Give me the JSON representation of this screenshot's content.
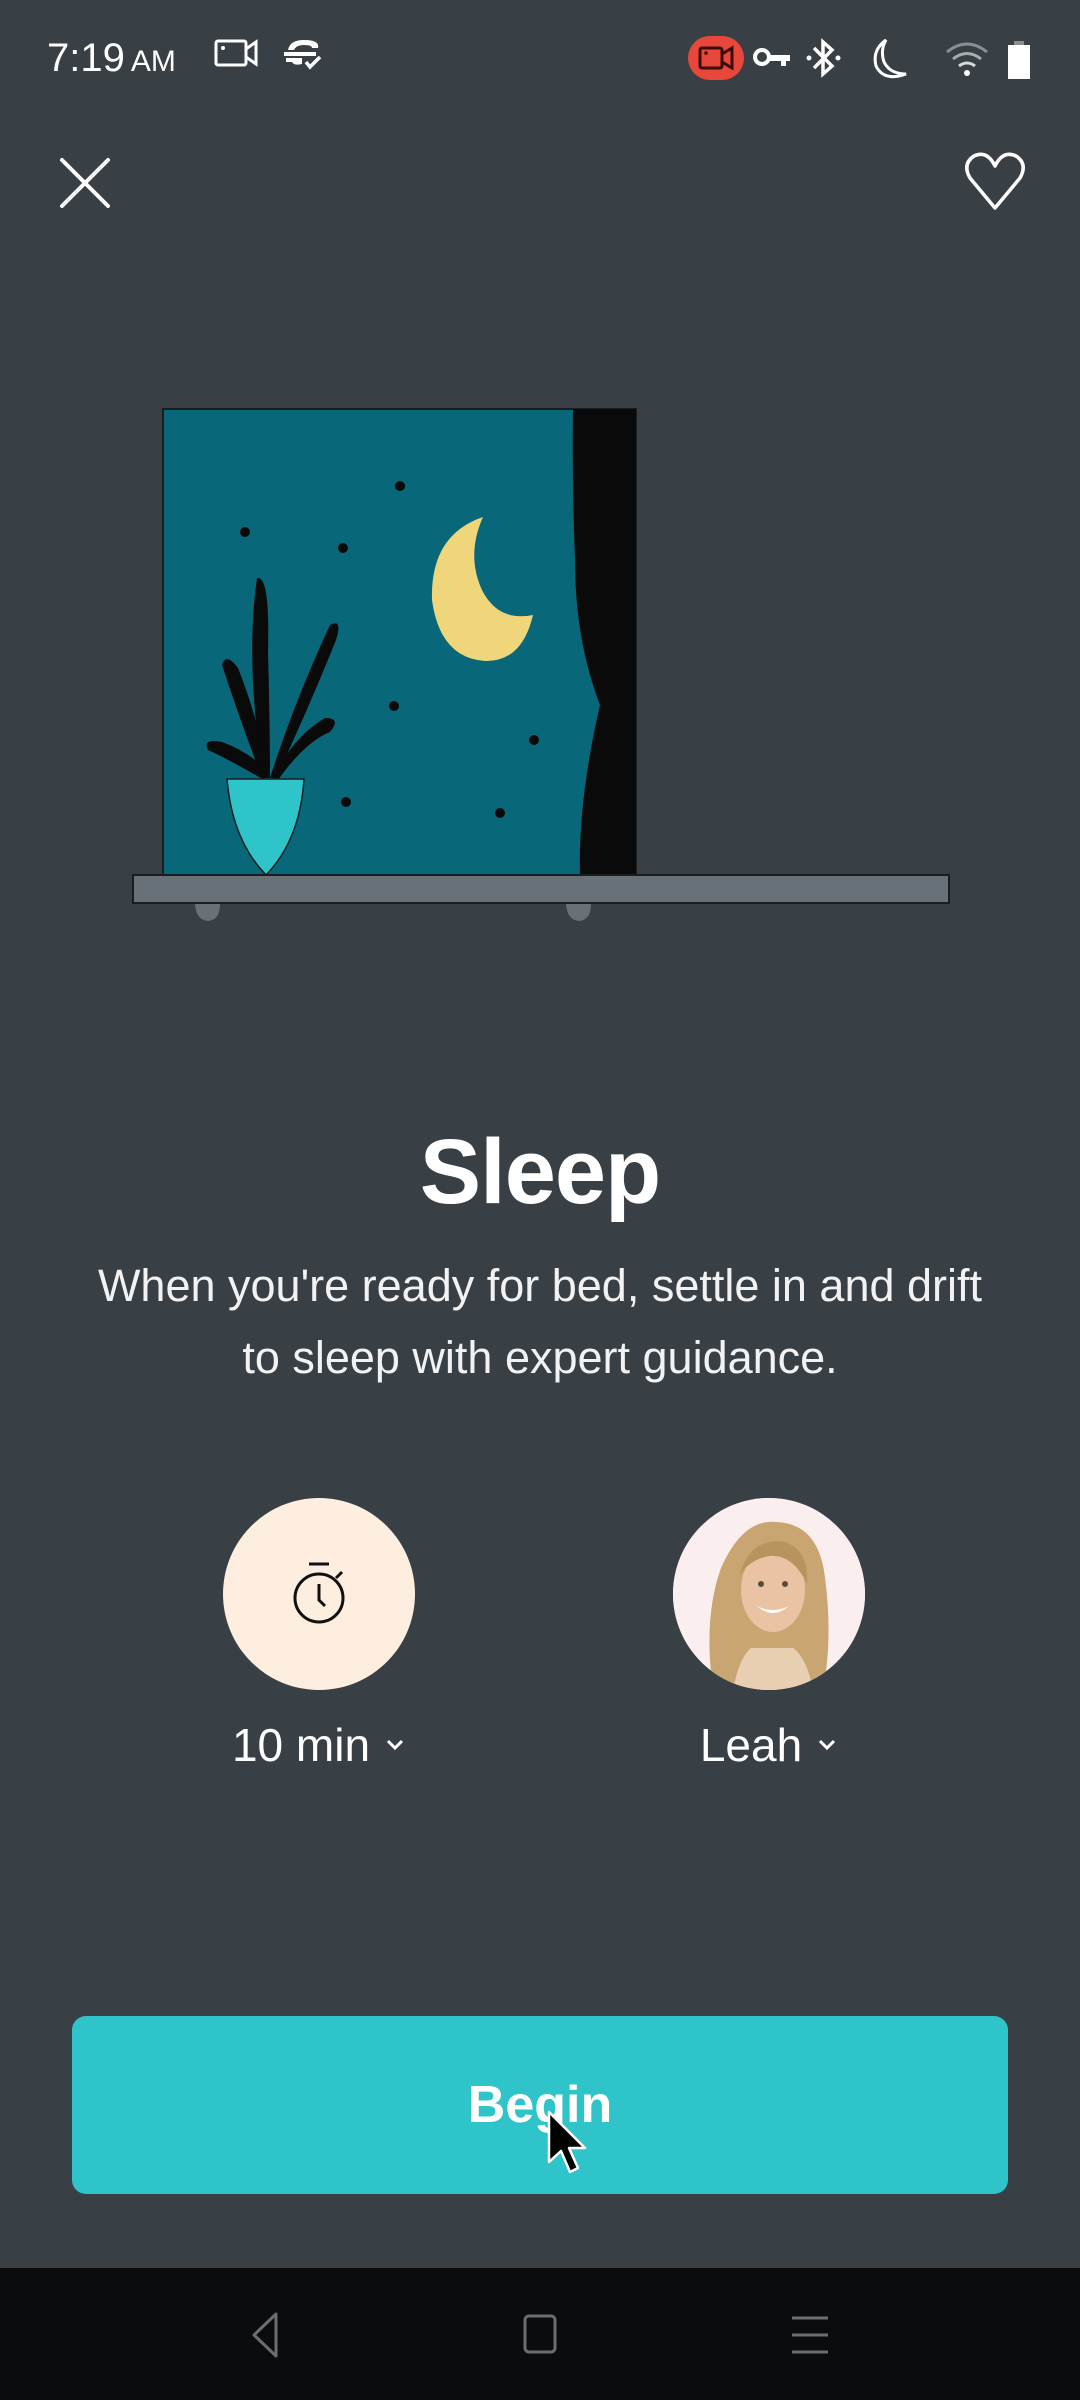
{
  "status_bar": {
    "time": "7:19",
    "ampm": "AM",
    "icons": [
      "video-camera-icon",
      "sync-check-icon",
      "screen-record-icon",
      "vpn-key-icon",
      "bluetooth-icon",
      "do-not-disturb-moon-icon",
      "wifi-icon",
      "battery-icon"
    ],
    "record_indicator_color": "#e8473c"
  },
  "header": {
    "close_icon": "close-icon",
    "favorite_icon": "heart-outline-icon"
  },
  "illustration": {
    "subject": "night window with crescent moon, stars, potted plant and curtain",
    "colors": {
      "sky": "#09677a",
      "moon": "#f0d67a",
      "pot": "#2ec4c9",
      "curtain": "#0a0a0b",
      "sill": "#687178",
      "plant": "#0a0a0b"
    }
  },
  "content": {
    "title": "Sleep",
    "description": "When you're ready for bed, settle in and drift to sleep with expert guidance."
  },
  "options": {
    "duration": {
      "value": "10 min",
      "icon": "stopwatch-icon"
    },
    "guide": {
      "value": "Leah",
      "icon": "guide-avatar"
    }
  },
  "actions": {
    "begin_label": "Begin",
    "accent_color": "#2ec4c9"
  },
  "nav_bar": {
    "back_icon": "back-triangle-icon",
    "home_icon": "home-square-icon",
    "recents_icon": "recents-lines-icon"
  }
}
